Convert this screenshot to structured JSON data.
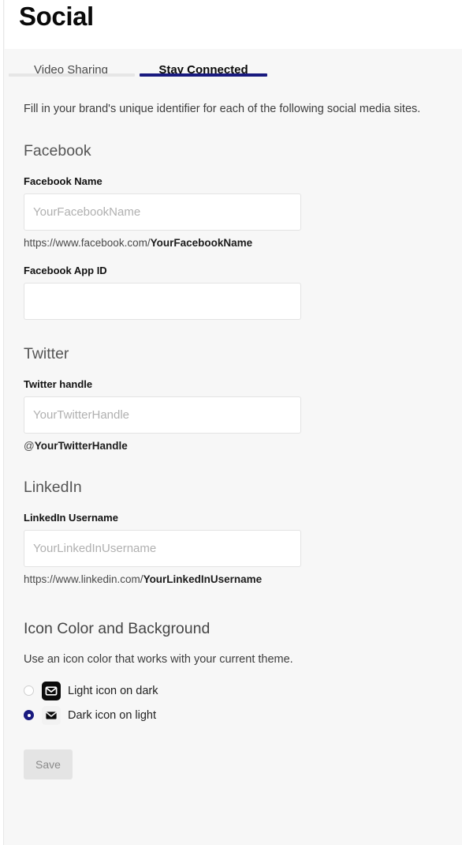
{
  "header": {
    "title": "Social"
  },
  "tabs": [
    {
      "label": "Video Sharing",
      "active": false
    },
    {
      "label": "Stay Connected",
      "active": true
    }
  ],
  "intro": "Fill in your brand's unique identifier for each of the following social media sites.",
  "sections": [
    {
      "title": "Facebook",
      "fields": [
        {
          "label": "Facebook Name",
          "value": "",
          "placeholder": "YourFacebookName",
          "helper_prefix": "https://www.facebook.com/",
          "helper_bold": "YourFacebookName"
        },
        {
          "label": "Facebook App ID",
          "value": "",
          "placeholder": "",
          "helper_prefix": "",
          "helper_bold": ""
        }
      ]
    },
    {
      "title": "Twitter",
      "fields": [
        {
          "label": "Twitter handle",
          "value": "",
          "placeholder": "YourTwitterHandle",
          "helper_prefix": "@",
          "helper_bold": "YourTwitterHandle"
        }
      ]
    },
    {
      "title": "LinkedIn",
      "fields": [
        {
          "label": "LinkedIn Username",
          "value": "",
          "placeholder": "YourLinkedInUsername",
          "helper_prefix": "https://www.linkedin.com/",
          "helper_bold": "YourLinkedInUsername"
        }
      ]
    }
  ],
  "icon_color": {
    "title": "Icon Color and Background",
    "description": "Use an icon color that works with your current theme.",
    "options": [
      {
        "label": "Light icon on dark",
        "selected": false,
        "icon": "mail-icon",
        "style": "dark-bg"
      },
      {
        "label": "Dark icon on light",
        "selected": true,
        "icon": "mail-icon",
        "style": "light-bg"
      }
    ]
  },
  "footer": {
    "save_label": "Save",
    "save_disabled": true
  },
  "colors": {
    "accent": "#191a7f",
    "page_bg": "#f7f7f7",
    "header_bg": "#ffffff",
    "input_border": "#e3e3e3",
    "disabled_button_bg": "#e4e4e4"
  }
}
